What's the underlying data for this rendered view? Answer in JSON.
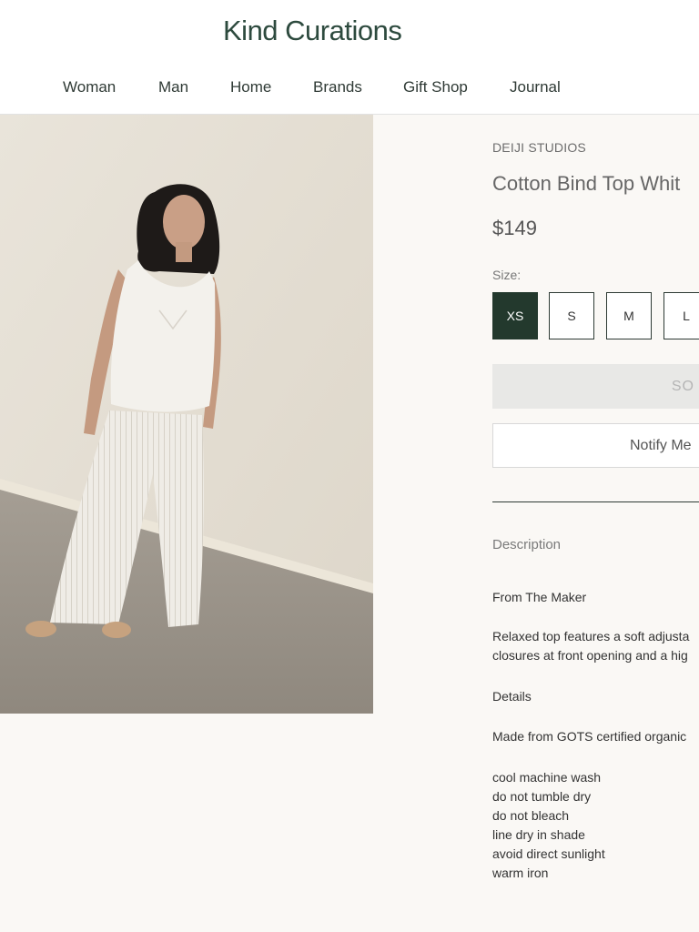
{
  "header": {
    "logo": "Kind Curations",
    "nav": [
      "Woman",
      "Man",
      "Home",
      "Brands",
      "Gift Shop",
      "Journal"
    ]
  },
  "product": {
    "brand": "DEIJI STUDIOS",
    "title": "Cotton Bind Top Whit",
    "price": "$149",
    "size_label": "Size:",
    "sizes": [
      "XS",
      "S",
      "M",
      "L"
    ],
    "selected_size": "XS",
    "soldout_label": "SO",
    "notify_label": "Notify Me"
  },
  "description": {
    "heading": "Description",
    "from_maker_heading": "From The Maker",
    "maker_line_1": "Relaxed top features a soft adjusta",
    "maker_line_2": "closures at front opening and a hig",
    "details_heading": "Details",
    "material": "Made from GOTS certified organic",
    "care": [
      "cool machine wash",
      "do not tumble dry",
      "do not bleach",
      "line dry in shade",
      "avoid direct sunlight",
      "warm iron"
    ]
  },
  "colors": {
    "brand_green": "#23392d",
    "background": "#faf8f5"
  }
}
